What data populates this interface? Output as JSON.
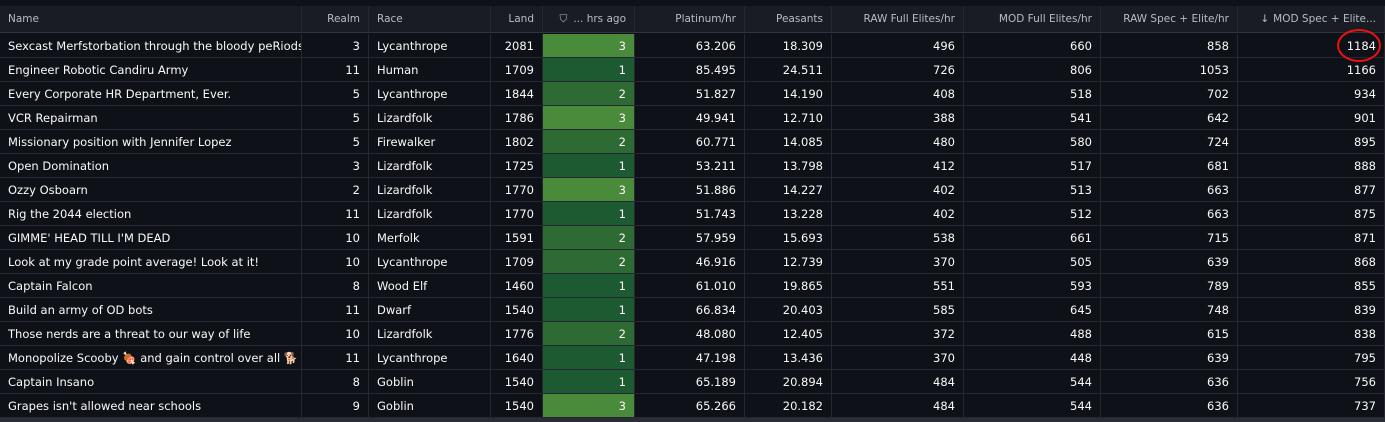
{
  "headers": {
    "name": "Name",
    "realm": "Realm",
    "race": "Race",
    "land": "Land",
    "hrs": "... hrs ago",
    "platinum": "Platinum/hr",
    "peasants": "Peasants",
    "raw_full": "RAW Full Elites/hr",
    "mod_full": "MOD Full Elites/hr",
    "raw_spec": "RAW Spec + Elite/hr",
    "mod_spec": "MOD Spec + Elite..."
  },
  "icons": {
    "filter": "filter-icon",
    "sort": "arrow-down-icon"
  },
  "rows": [
    {
      "name": "Sexcast Merfstorbation through the bloody peRiods",
      "realm": "3",
      "race": "Lycanthrope",
      "land": "2081",
      "hrs": "3",
      "platinum": "63.206",
      "peasants": "18.309",
      "raw_full": "496",
      "mod_full": "660",
      "raw_spec": "858",
      "mod_spec": "1184"
    },
    {
      "name": "Engineer Robotic Candiru Army",
      "realm": "11",
      "race": "Human",
      "land": "1709",
      "hrs": "1",
      "platinum": "85.495",
      "peasants": "24.511",
      "raw_full": "726",
      "mod_full": "806",
      "raw_spec": "1053",
      "mod_spec": "1166"
    },
    {
      "name": "Every Corporate HR Department, Ever.",
      "realm": "5",
      "race": "Lycanthrope",
      "land": "1844",
      "hrs": "2",
      "platinum": "51.827",
      "peasants": "14.190",
      "raw_full": "408",
      "mod_full": "518",
      "raw_spec": "702",
      "mod_spec": "934"
    },
    {
      "name": "VCR Repairman",
      "realm": "5",
      "race": "Lizardfolk",
      "land": "1786",
      "hrs": "3",
      "platinum": "49.941",
      "peasants": "12.710",
      "raw_full": "388",
      "mod_full": "541",
      "raw_spec": "642",
      "mod_spec": "901"
    },
    {
      "name": "Missionary position with Jennifer Lopez",
      "realm": "5",
      "race": "Firewalker",
      "land": "1802",
      "hrs": "2",
      "platinum": "60.771",
      "peasants": "14.085",
      "raw_full": "480",
      "mod_full": "580",
      "raw_spec": "724",
      "mod_spec": "895"
    },
    {
      "name": "Open Domination",
      "realm": "3",
      "race": "Lizardfolk",
      "land": "1725",
      "hrs": "1",
      "platinum": "53.211",
      "peasants": "13.798",
      "raw_full": "412",
      "mod_full": "517",
      "raw_spec": "681",
      "mod_spec": "888"
    },
    {
      "name": "Ozzy Osboarn",
      "realm": "2",
      "race": "Lizardfolk",
      "land": "1770",
      "hrs": "3",
      "platinum": "51.886",
      "peasants": "14.227",
      "raw_full": "402",
      "mod_full": "513",
      "raw_spec": "663",
      "mod_spec": "877"
    },
    {
      "name": "Rig the 2044 election",
      "realm": "11",
      "race": "Lizardfolk",
      "land": "1770",
      "hrs": "1",
      "platinum": "51.743",
      "peasants": "13.228",
      "raw_full": "402",
      "mod_full": "512",
      "raw_spec": "663",
      "mod_spec": "875"
    },
    {
      "name": "GIMME' HEAD TILL I'M DEAD",
      "realm": "10",
      "race": "Merfolk",
      "land": "1591",
      "hrs": "2",
      "platinum": "57.959",
      "peasants": "15.693",
      "raw_full": "538",
      "mod_full": "661",
      "raw_spec": "715",
      "mod_spec": "871"
    },
    {
      "name": "Look at my grade point average! Look at it!",
      "realm": "10",
      "race": "Lycanthrope",
      "land": "1709",
      "hrs": "2",
      "platinum": "46.916",
      "peasants": "12.739",
      "raw_full": "370",
      "mod_full": "505",
      "raw_spec": "639",
      "mod_spec": "868"
    },
    {
      "name": "Captain Falcon",
      "realm": "8",
      "race": "Wood Elf",
      "land": "1460",
      "hrs": "1",
      "platinum": "61.010",
      "peasants": "19.865",
      "raw_full": "551",
      "mod_full": "593",
      "raw_spec": "789",
      "mod_spec": "855"
    },
    {
      "name": "Build an army of OD bots",
      "realm": "11",
      "race": "Dwarf",
      "land": "1540",
      "hrs": "1",
      "platinum": "66.834",
      "peasants": "20.403",
      "raw_full": "585",
      "mod_full": "645",
      "raw_spec": "748",
      "mod_spec": "839"
    },
    {
      "name": "Those nerds are a threat to our way of life",
      "realm": "10",
      "race": "Lizardfolk",
      "land": "1776",
      "hrs": "2",
      "platinum": "48.080",
      "peasants": "12.405",
      "raw_full": "372",
      "mod_full": "488",
      "raw_spec": "615",
      "mod_spec": "838"
    },
    {
      "name": "Monopolize Scooby 🍖 and gain control over all 🐕",
      "realm": "11",
      "race": "Lycanthrope",
      "land": "1640",
      "hrs": "1",
      "platinum": "47.198",
      "peasants": "13.436",
      "raw_full": "370",
      "mod_full": "448",
      "raw_spec": "639",
      "mod_spec": "795"
    },
    {
      "name": "Captain Insano",
      "realm": "8",
      "race": "Goblin",
      "land": "1540",
      "hrs": "1",
      "platinum": "65.189",
      "peasants": "20.894",
      "raw_full": "484",
      "mod_full": "544",
      "raw_spec": "636",
      "mod_spec": "756"
    },
    {
      "name": "Grapes isn't allowed near schools",
      "realm": "9",
      "race": "Goblin",
      "land": "1540",
      "hrs": "3",
      "platinum": "65.266",
      "peasants": "20.182",
      "raw_full": "484",
      "mod_full": "544",
      "raw_spec": "636",
      "mod_spec": "737"
    }
  ],
  "colors": {
    "highlight_circle": "#e11111",
    "hrs_1": "#1e5a31",
    "hrs_2": "#2e6a33",
    "hrs_3": "#4a8a3b"
  }
}
